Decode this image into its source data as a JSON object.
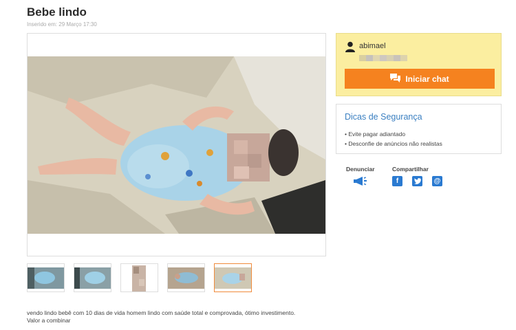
{
  "ad": {
    "title": "Bebe lindo",
    "inserted": "Inserido em: 29 Março 17:30",
    "description_line1": "vendo lindo bebê com 10 dias de vida homem lindo com saúde total e comprovada, ótimo investimento.",
    "description_line2": "Valor a combinar"
  },
  "gallery": {
    "thumb_count": 5,
    "active_index": 4
  },
  "seller": {
    "name": "abimael",
    "icon": "user-icon"
  },
  "chat": {
    "label": "Iniciar chat",
    "icon": "chat-bubble-icon",
    "color": "#f5821f"
  },
  "safety": {
    "title": "Dicas de Segurança",
    "tips": [
      "Evite pagar adiantado",
      "Desconfie de anúncios não realistas"
    ],
    "title_color": "#3a7fc1"
  },
  "actions": {
    "report_label": "Denunciar",
    "share_label": "Compartilhar",
    "report_icon": "megaphone-icon",
    "share_icons": [
      "facebook-icon",
      "twitter-icon",
      "email-icon"
    ]
  },
  "colors": {
    "card_yellow": "#fbeea0",
    "link_blue": "#2a7ad1"
  }
}
